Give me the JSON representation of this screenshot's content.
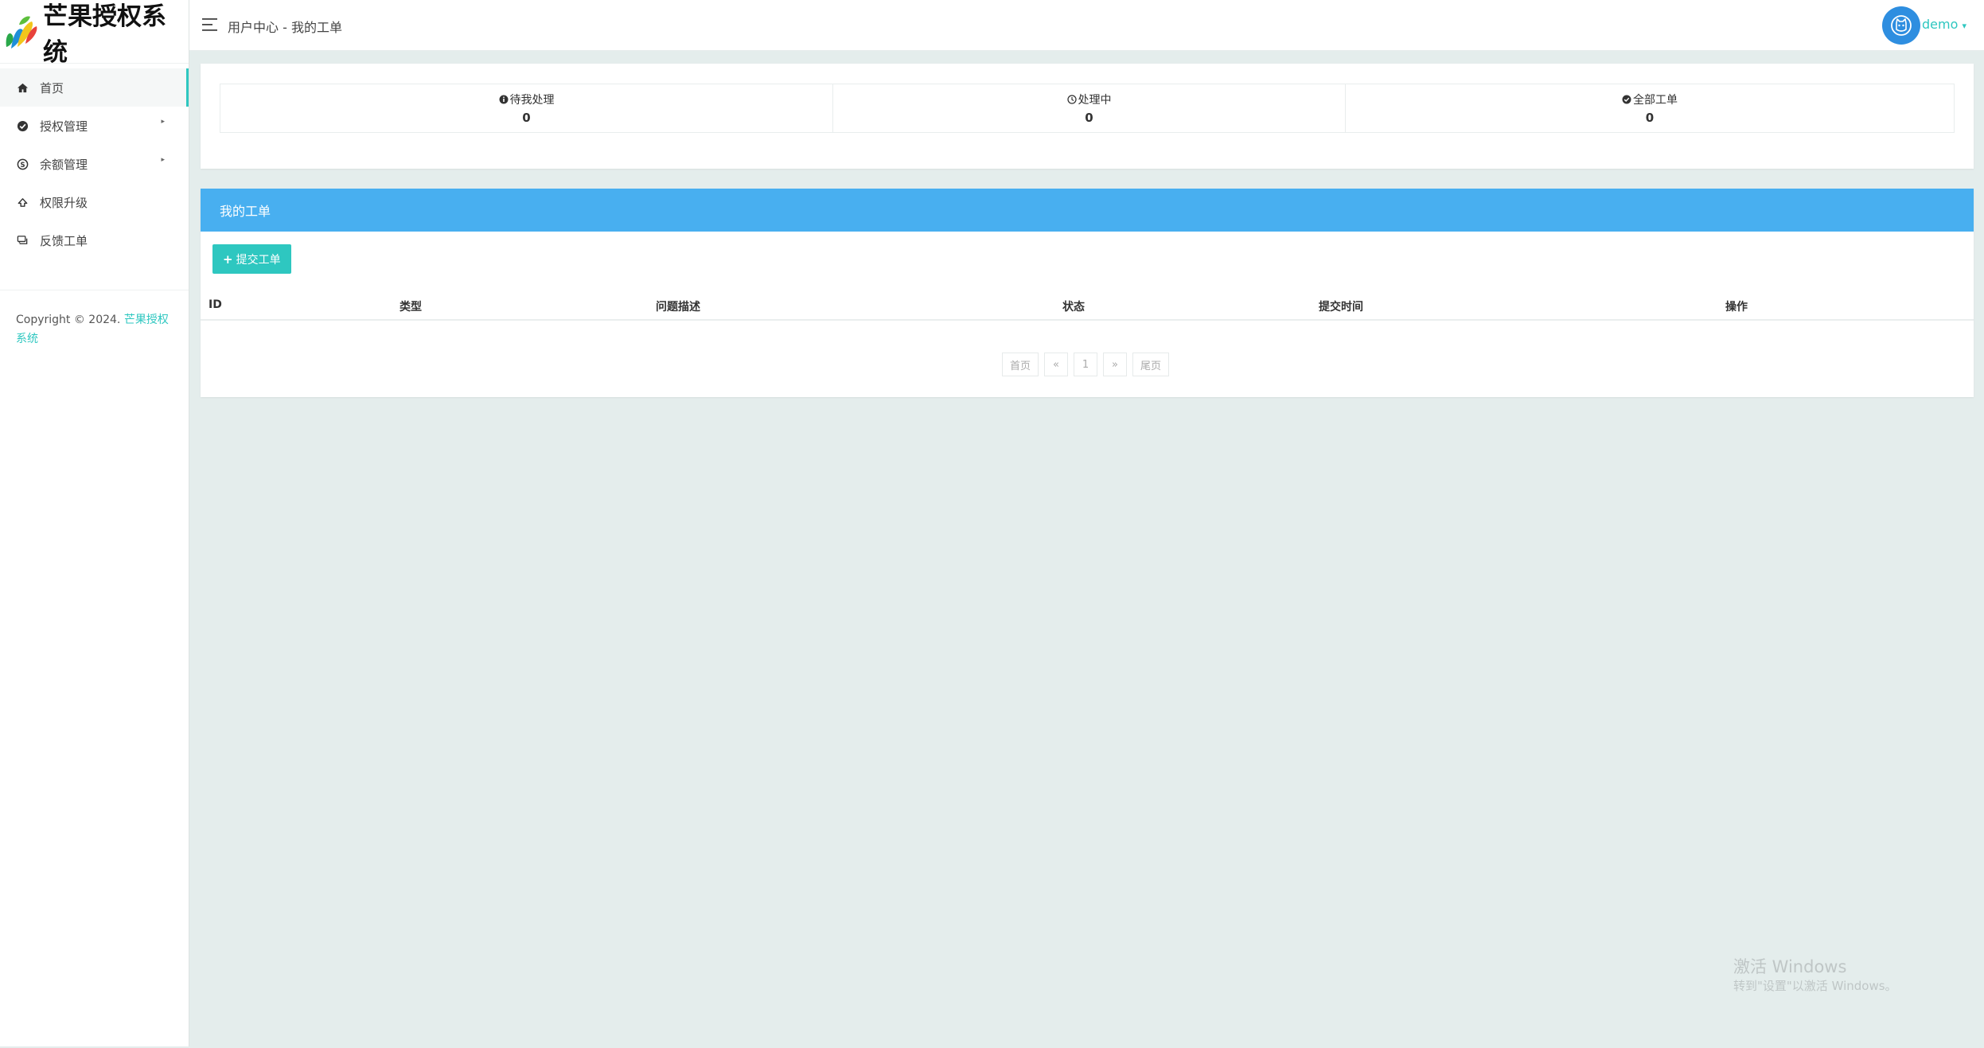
{
  "brand": {
    "name": "芒果授权系统"
  },
  "sidebar": {
    "items": [
      {
        "label": "首页",
        "icon": "home-icon",
        "active": true
      },
      {
        "label": "授权管理",
        "icon": "check-circle-icon",
        "has_submenu": true
      },
      {
        "label": "余额管理",
        "icon": "skype-icon",
        "has_submenu": true
      },
      {
        "label": "权限升级",
        "icon": "arrow-up-icon"
      },
      {
        "label": "反馈工单",
        "icon": "comments-icon"
      }
    ],
    "copyright_prefix": "Copyright © 2024.",
    "copyright_link": "芒果授权系统"
  },
  "header": {
    "breadcrumb": "用户中心 - 我的工单",
    "username": "demo",
    "username_caret": "▾"
  },
  "stats": [
    {
      "label": "待我处理",
      "value": "0",
      "icon": "info-circle-icon"
    },
    {
      "label": "处理中",
      "value": "0",
      "icon": "clock-icon"
    },
    {
      "label": "全部工单",
      "value": "0",
      "icon": "check-circle-icon"
    }
  ],
  "tickets": {
    "title": "我的工单",
    "submit_plus": "+",
    "submit_label": "提交工单",
    "columns": [
      "ID",
      "类型",
      "问题描述",
      "状态",
      "提交时间",
      "操作"
    ],
    "rows": []
  },
  "pagination": {
    "first": "首页",
    "prev": "«",
    "current": "1",
    "next": "»",
    "last": "尾页"
  },
  "watermark": {
    "title": "激活 Windows",
    "subtitle": "转到\"设置\"以激活 Windows。"
  },
  "colors": {
    "accent": "#2ec7c0",
    "panel_header": "#48aff0",
    "avatar": "#2e8ee0",
    "page_bg": "#e4edec"
  }
}
